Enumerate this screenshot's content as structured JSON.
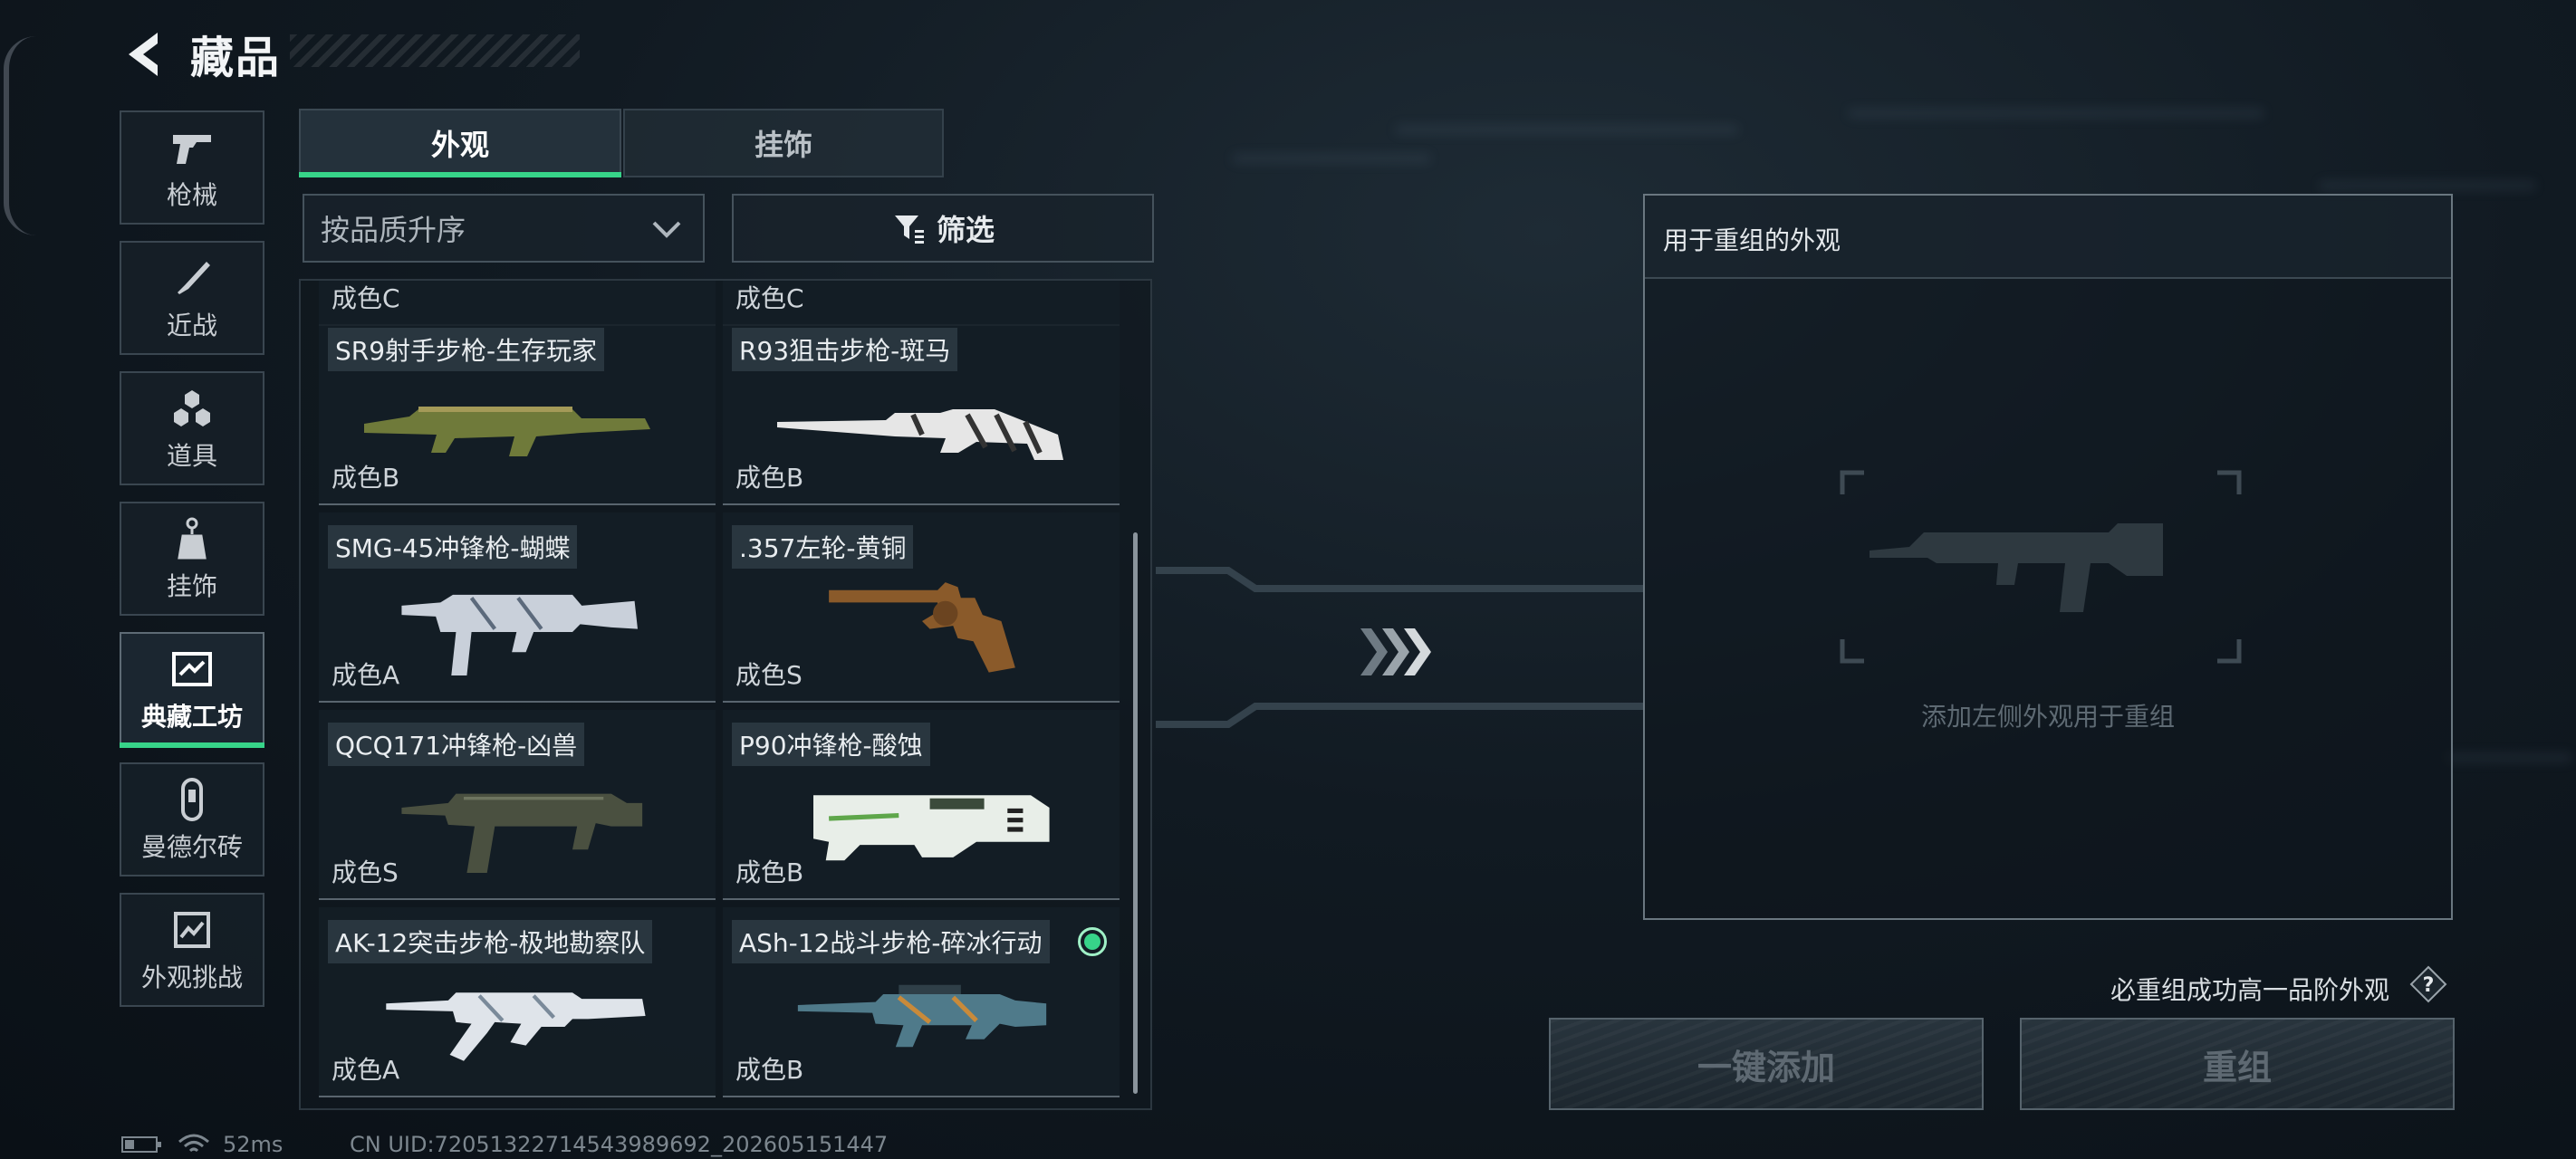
{
  "header": {
    "title": "藏品"
  },
  "nav": [
    {
      "label": "枪械",
      "icon": "gun-icon"
    },
    {
      "label": "近战",
      "icon": "knife-icon"
    },
    {
      "label": "道具",
      "icon": "items-icon"
    },
    {
      "label": "挂饰",
      "icon": "charm-icon"
    },
    {
      "label": "典藏工坊",
      "icon": "workshop-icon",
      "active": true
    },
    {
      "label": "曼德尔砖",
      "icon": "brick-icon"
    },
    {
      "label": "外观挑战",
      "icon": "challenge-icon"
    }
  ],
  "tabs": [
    {
      "label": "外观",
      "active": true
    },
    {
      "label": "挂饰",
      "active": false
    }
  ],
  "sort": {
    "label": "按品质升序"
  },
  "filter": {
    "label": "筛选"
  },
  "list": {
    "top_partial": [
      "成色C",
      "成色C"
    ],
    "items": [
      {
        "name": "SR9射手步枪-生存玩家",
        "grade": "成色B",
        "color": "#6f7a3a"
      },
      {
        "name": "R93狙击步枪-斑马",
        "grade": "成色B",
        "color": "#e6e6e6"
      },
      {
        "name": "SMG-45冲锋枪-蝴蝶",
        "grade": "成色A",
        "color": "#c9d0da"
      },
      {
        "name": ".357左轮-黄铜",
        "grade": "成色S",
        "color": "#8a5a2a"
      },
      {
        "name": "QCQ171冲锋枪-凶兽",
        "grade": "成色S",
        "color": "#4a5040"
      },
      {
        "name": "P90冲锋枪-酸蚀",
        "grade": "成色B",
        "color": "#e8eee8"
      },
      {
        "name": "AK-12突击步枪-极地勘察队",
        "grade": "成色A",
        "color": "#dfe4ea"
      },
      {
        "name": "ASh-12战斗步枪-碎冰行动",
        "grade": "成色B",
        "color": "#4f7a8a",
        "selected": true
      }
    ]
  },
  "panel": {
    "title": "用于重组的外观",
    "hint": "添加左侧外观用于重组"
  },
  "guarantee": "必重组成功高一品阶外观",
  "buttons": {
    "add": "一键添加",
    "recombine": "重组"
  },
  "status": {
    "ping": "52ms",
    "uid": "CN UID:720513227145439896​92_202605151447"
  }
}
